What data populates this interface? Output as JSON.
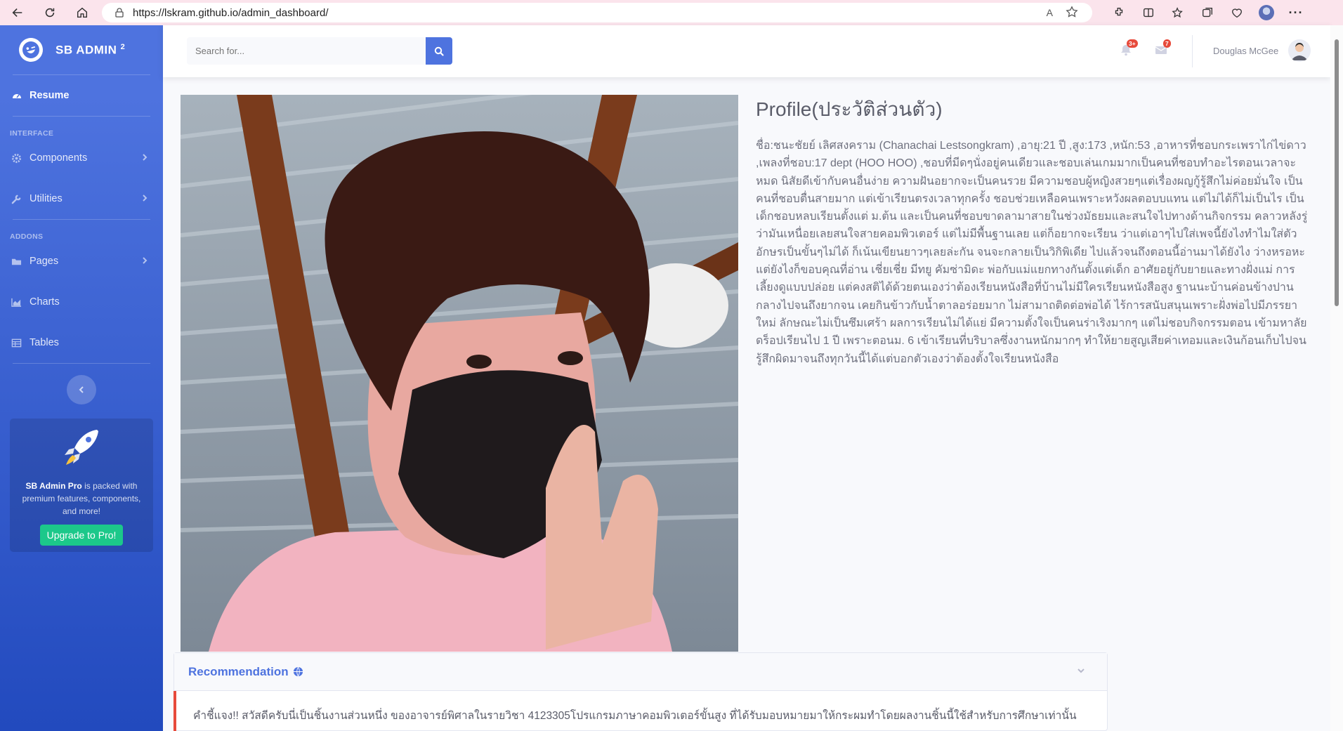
{
  "browser": {
    "url": "https://lskram.github.io/admin_dashboard/",
    "read_aloud": "A",
    "icons": [
      "back-icon",
      "refresh-icon",
      "home-icon",
      "lock-icon",
      "read-aloud-icon",
      "favorite-star-icon",
      "extensions-icon",
      "split-screen-icon",
      "favorites-icon",
      "collections-icon",
      "browser-essentials-icon",
      "profile-avatar",
      "more-icon"
    ]
  },
  "sidebar": {
    "brand": "SB ADMIN",
    "brand_sup": "2",
    "items": [
      {
        "label": "Resume",
        "icon": "tachometer-icon",
        "active": true
      },
      {
        "heading": "INTERFACE"
      },
      {
        "label": "Components",
        "icon": "cog-icon"
      },
      {
        "label": "Utilities",
        "icon": "wrench-icon"
      },
      {
        "heading": "ADDONS"
      },
      {
        "label": "Pages",
        "icon": "folder-icon"
      },
      {
        "label": "Charts",
        "icon": "chart-area-icon"
      },
      {
        "label": "Tables",
        "icon": "table-icon"
      }
    ],
    "heading_interface": "INTERFACE",
    "heading_addons": "ADDONS",
    "labels": {
      "resume": "Resume",
      "components": "Components",
      "utilities": "Utilities",
      "pages": "Pages",
      "charts": "Charts",
      "tables": "Tables"
    },
    "toggle_icon": "chevron-left-icon",
    "promo": {
      "brand": "SB Admin Pro",
      "text": " is packed with premium features, components, and more!",
      "button": "Upgrade to Pro!"
    }
  },
  "topbar": {
    "search_placeholder": "Search for...",
    "alerts_badge": "3+",
    "messages_badge": "7",
    "user_name": "Douglas McGee"
  },
  "main": {
    "profile_title": "Profile(ประวัติส่วนตัว)",
    "bio": "ชื่อ:ชนะชัยย์ เลิศสงคราม (Chanachai Lestsongkram) ,อายุ:21 ปี ,สูง:173 ,หนัก:53 ,อาหารที่ชอบกระเพราไก่ไข่ดาว ,เพลงที่ชอบ:17 dept (HOO HOO) ,ชอบที่มีดๆนั่งอยู่คนเดียวและชอบเล่นเกมมากเป็นคนที่ชอบทำอะไรตอนเวลาจะหมด นิสัยดีเข้ากับคนอื่นง่าย ความฝันอยากจะเป็นคนรวย มีความชอบผู้หญิงสวยๆแต่เรื่องผญกู้รู้สึกไม่ค่อยมั่นใจ เป็นคนที่ชอบตื่นสายมาก แต่เข้าเรียนตรงเวลาทุกครั้ง ชอบช่วยเหลือคนเพราะหวังผลตอบบแทน แต่ไม่ได้ก็ไม่เป็นไร เป็นเด็กชอบหลบเรียนตั้งแต่ ม.ต้น และเป็นคนที่ชอบขาดลามาสายในช่วงมัธยมและสนใจไปทางด้านกิจกรรม คลาวหลังรู่ว่ามันเหนื่อยเลยสนใจสายคอมพิวเตอร์ แต่ไม่มีพื้นฐานเลย แต่ก็อยากจะเรียน ว่าแต่เอาๆไปใส่เพจนี้ยังไงทำไมใส่ตัวอักษรเป็นขั้นๆไม่ได้ ก็เน้นเขียนยาวๆเลยล่ะกัน จนจะกลายเป็นวิกิพิเดีย ไปแล้วจนถึงตอนนี้อ่านมาได้ยังไง ว่างหรอหะแต่ยังไงก็ขอบคุณที่อ่าน เชี่ยเชี่ย มีทยู คัมซ่ามิดะ พ่อกับแม่แยกทางกันตั้งแต่เด็ก อาศัยอยู่กับยายและทางฝั่งแม่ การเลี้ยงดูแบบปล่อย แต่คงสติได้ด้วยตนเองว่าต้องเรียนหนังสือที่บ้านไม่มีใครเรียนหนังสือสูง ฐานนะบ้านค่อนข้างปานกลางไปจนถึงยากจน เคยกินข้าวกับน้ำตาลอร่อยมาก ไม่สามาถติดต่อพ่อได้ ไร้การสนับสนุนเพราะฝั่งพ่อไปมีภรรยาใหม่ ลักษณะไม่เป็นซึมเศร้า ผลการเรียนไม่ได้แย่ มีความตั้งใจเป็นคนร่าเริงมากๆ แต่ไม่ชอบกิจกรรมตอน เข้ามหาลัย ดร็อปเรียนไป 1 ปี เพราะตอนม. 6 เข้าเรียนที่บริบาลซึ่งงานหนักมากๆ ทำให้ยายสูญเสียค่าเทอมและเงินก้อนเก็บไปจนรู้สึกผิดมาจนถึงทุกวันนี้ได้แต่บอกตัวเองว่าต้องตั้งใจเรียนหนังสือ",
    "recommendation_title": "Recommendation",
    "recommendation_text": "คำชี้แจง!! สวัสดีครับนี่เป็นชิ้นงานส่วนหนึ่ง ของอาจารย์พิศาลในรายวิชา 4123305โปรแกรมภาษาคอมพิวเตอร์ขั้นสูง ที่ได้รับมอบหมายมาให้กระผมทำโดยผลงานชิ้นนี้ใช้สำหรับการศึกษาเท่านั้น"
  },
  "colors": {
    "primary": "#4e73df",
    "success": "#1cc88a",
    "danger": "#e74a3b"
  }
}
